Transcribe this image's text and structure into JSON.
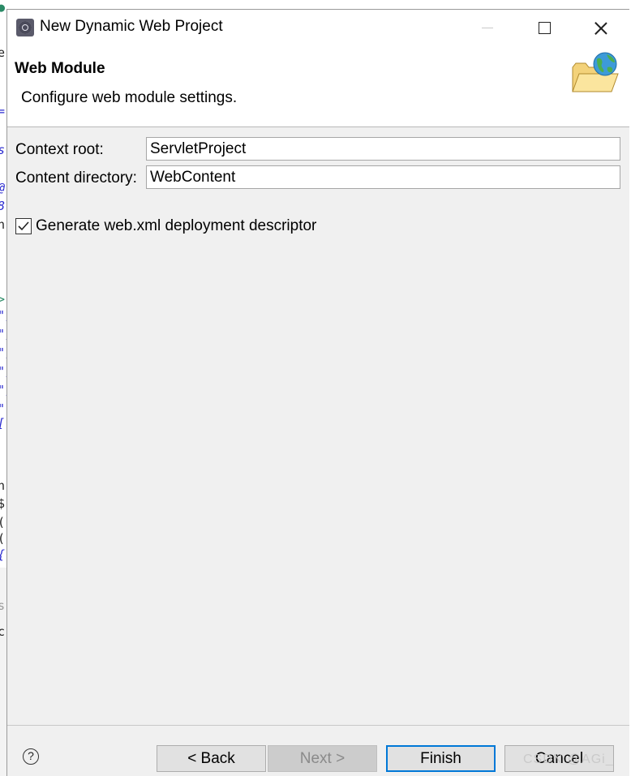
{
  "window": {
    "title": "New Dynamic Web Project",
    "icon": "eclipse-gear-icon"
  },
  "banner": {
    "title": "Web Module",
    "description": "Configure web module settings.",
    "image": "folder-globe-icon"
  },
  "form": {
    "context_root_label": "Context root:",
    "context_root_value": "ServletProject",
    "content_directory_label": "Content directory:",
    "content_directory_value": "WebContent",
    "generate_descriptor_label": "Generate web.xml deployment descriptor",
    "generate_descriptor_checked": true
  },
  "footer": {
    "help_icon": "help-icon",
    "help_glyph": "?",
    "back_label": "< Back",
    "next_label": "Next >",
    "next_enabled": false,
    "finish_label": "Finish",
    "cancel_label": "Cancel"
  },
  "watermark": "CSDN @AGi_",
  "background_fragments": [
    "=",
    "s",
    "@",
    "8",
    "n",
    ">",
    "\",",
    "\",",
    "\",",
    "\",",
    "\",",
    "\"[",
    "n",
    "$",
    "(",
    "(",
    "{",
    ",",
    "s",
    "c"
  ],
  "colors": {
    "finish_border": "#0078d7",
    "dialog_bg": "#f0f0f0"
  }
}
